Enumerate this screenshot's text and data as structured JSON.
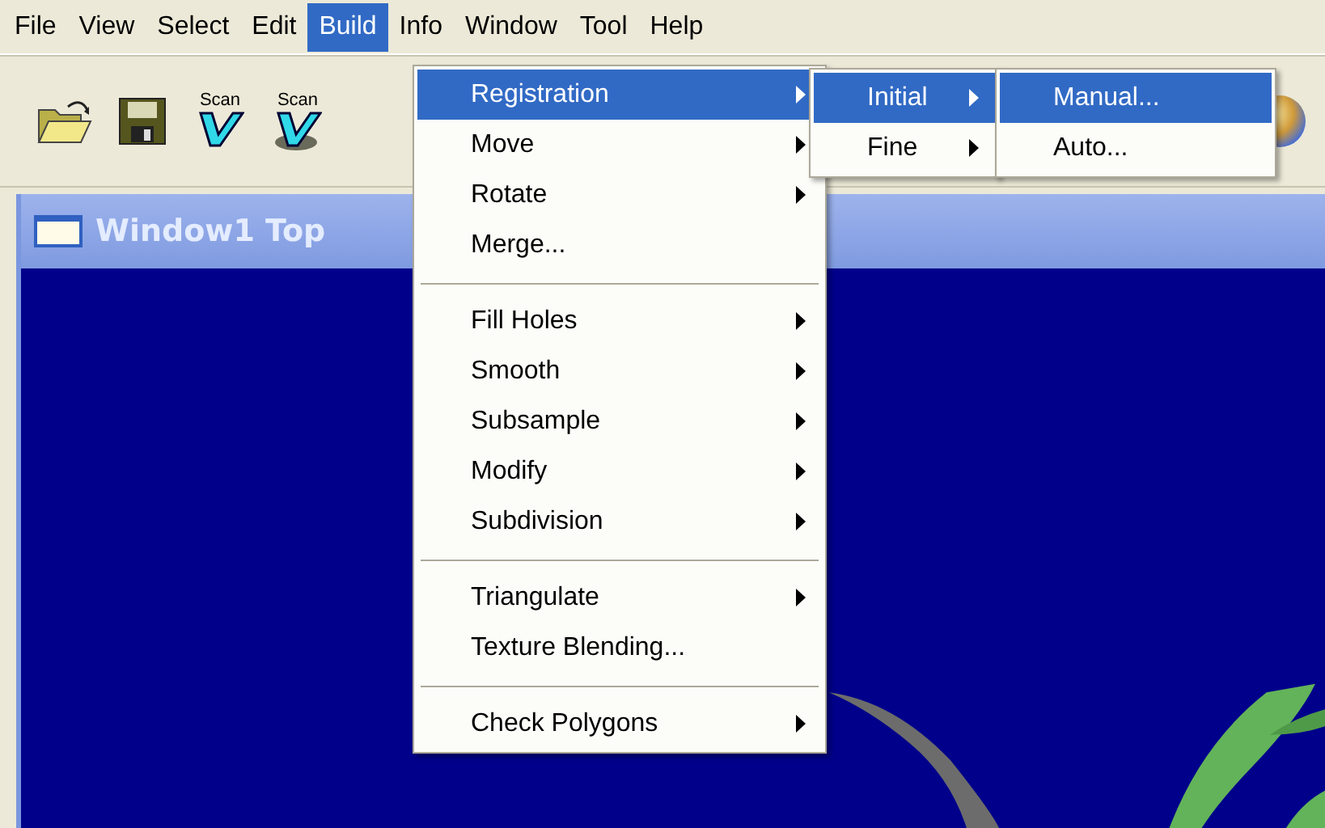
{
  "menubar": [
    {
      "label": "File",
      "selected": false
    },
    {
      "label": "View",
      "selected": false
    },
    {
      "label": "Select",
      "selected": false
    },
    {
      "label": "Edit",
      "selected": false
    },
    {
      "label": "Build",
      "selected": true
    },
    {
      "label": "Info",
      "selected": false
    },
    {
      "label": "Window",
      "selected": false
    },
    {
      "label": "Tool",
      "selected": false
    },
    {
      "label": "Help",
      "selected": false
    }
  ],
  "toolbar": [
    {
      "kind": "open"
    },
    {
      "kind": "save"
    },
    {
      "kind": "scan",
      "label": "Scan"
    },
    {
      "kind": "scan-tray",
      "label": "Scan"
    },
    {
      "kind": "sphere"
    }
  ],
  "window": {
    "title": "Window1 Top"
  },
  "menu": {
    "items": [
      {
        "kind": "item",
        "label": "Registration",
        "submenu": true,
        "selected": true
      },
      {
        "kind": "item",
        "label": "Move",
        "submenu": true,
        "selected": false
      },
      {
        "kind": "item",
        "label": "Rotate",
        "submenu": true,
        "selected": false
      },
      {
        "kind": "item",
        "label": "Merge...",
        "submenu": false,
        "selected": false
      },
      {
        "kind": "separator"
      },
      {
        "kind": "item",
        "label": "Fill Holes",
        "submenu": true,
        "selected": false
      },
      {
        "kind": "item",
        "label": "Smooth",
        "submenu": true,
        "selected": false
      },
      {
        "kind": "item",
        "label": "Subsample",
        "submenu": true,
        "selected": false
      },
      {
        "kind": "item",
        "label": "Modify",
        "submenu": true,
        "selected": false
      },
      {
        "kind": "item",
        "label": "Subdivision",
        "submenu": true,
        "selected": false
      },
      {
        "kind": "separator"
      },
      {
        "kind": "item",
        "label": "Triangulate",
        "submenu": true,
        "selected": false
      },
      {
        "kind": "item",
        "label": "Texture Blending...",
        "submenu": false,
        "selected": false
      },
      {
        "kind": "separator"
      },
      {
        "kind": "item",
        "label": "Check Polygons",
        "submenu": true,
        "selected": false
      }
    ]
  },
  "submenu": {
    "items": [
      {
        "kind": "item",
        "label": "Initial",
        "submenu": true,
        "selected": true
      },
      {
        "kind": "item",
        "label": "Fine",
        "submenu": true,
        "selected": false
      }
    ]
  },
  "submenu_2": {
    "items": [
      {
        "kind": "item",
        "label": "Manual...",
        "submenu": false,
        "selected": true
      },
      {
        "kind": "item",
        "label": "Auto...",
        "submenu": false,
        "selected": false
      }
    ]
  }
}
